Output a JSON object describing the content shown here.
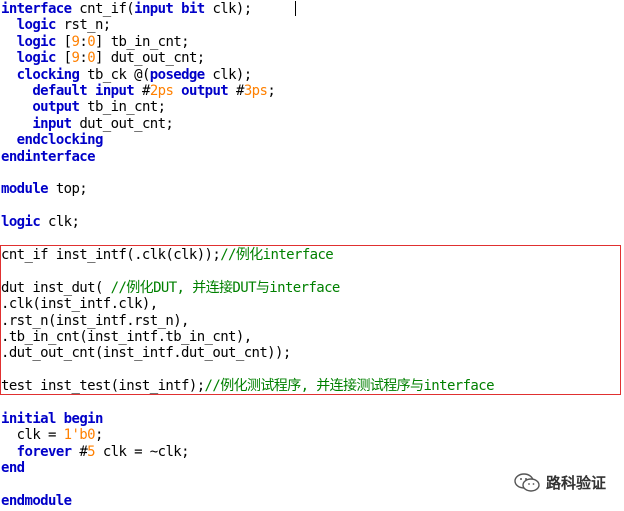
{
  "code_lines": [
    [
      {
        "t": "interface",
        "k": "kw"
      },
      {
        "t": " cnt_if(",
        "k": "id"
      },
      {
        "t": "input",
        "k": "kw"
      },
      {
        "t": " ",
        "k": "id"
      },
      {
        "t": "bit",
        "k": "kw"
      },
      {
        "t": " clk);",
        "k": "id"
      }
    ],
    [
      {
        "t": "  ",
        "k": "id"
      },
      {
        "t": "logic",
        "k": "kw"
      },
      {
        "t": " rst_n;",
        "k": "id"
      }
    ],
    [
      {
        "t": "  ",
        "k": "id"
      },
      {
        "t": "logic",
        "k": "kw"
      },
      {
        "t": " [",
        "k": "id"
      },
      {
        "t": "9",
        "k": "num"
      },
      {
        "t": ":",
        "k": "id"
      },
      {
        "t": "0",
        "k": "num"
      },
      {
        "t": "] tb_in_cnt;",
        "k": "id"
      }
    ],
    [
      {
        "t": "  ",
        "k": "id"
      },
      {
        "t": "logic",
        "k": "kw"
      },
      {
        "t": " [",
        "k": "id"
      },
      {
        "t": "9",
        "k": "num"
      },
      {
        "t": ":",
        "k": "id"
      },
      {
        "t": "0",
        "k": "num"
      },
      {
        "t": "] dut_out_cnt;",
        "k": "id"
      }
    ],
    [
      {
        "t": "  ",
        "k": "id"
      },
      {
        "t": "clocking",
        "k": "kw"
      },
      {
        "t": " tb_ck @(",
        "k": "id"
      },
      {
        "t": "posedge",
        "k": "kw"
      },
      {
        "t": " clk);",
        "k": "id"
      }
    ],
    [
      {
        "t": "    ",
        "k": "id"
      },
      {
        "t": "default",
        "k": "kw"
      },
      {
        "t": " ",
        "k": "id"
      },
      {
        "t": "input",
        "k": "kw"
      },
      {
        "t": " #",
        "k": "id"
      },
      {
        "t": "2ps",
        "k": "num"
      },
      {
        "t": " ",
        "k": "id"
      },
      {
        "t": "output",
        "k": "kw"
      },
      {
        "t": " #",
        "k": "id"
      },
      {
        "t": "3ps",
        "k": "num"
      },
      {
        "t": ";",
        "k": "id"
      }
    ],
    [
      {
        "t": "    ",
        "k": "id"
      },
      {
        "t": "output",
        "k": "kw"
      },
      {
        "t": " tb_in_cnt;",
        "k": "id"
      }
    ],
    [
      {
        "t": "    ",
        "k": "id"
      },
      {
        "t": "input",
        "k": "kw"
      },
      {
        "t": " dut_out_cnt;",
        "k": "id"
      }
    ],
    [
      {
        "t": "  ",
        "k": "id"
      },
      {
        "t": "endclocking",
        "k": "kw"
      }
    ],
    [
      {
        "t": "endinterface",
        "k": "kw"
      }
    ],
    [],
    [
      {
        "t": "module",
        "k": "kw"
      },
      {
        "t": " top;",
        "k": "id"
      }
    ],
    [],
    [
      {
        "t": "logic",
        "k": "kw"
      },
      {
        "t": " clk;",
        "k": "id"
      }
    ],
    [],
    [
      {
        "t": "cnt_if inst_intf(.clk(clk));",
        "k": "id"
      },
      {
        "t": "//例化interface",
        "k": "cm"
      }
    ],
    [],
    [
      {
        "t": "dut inst_dut( ",
        "k": "id"
      },
      {
        "t": "//例化DUT, 并连接DUT与interface",
        "k": "cm"
      }
    ],
    [
      {
        "t": ".clk(inst_intf.clk),",
        "k": "id"
      }
    ],
    [
      {
        "t": ".rst_n(inst_intf.rst_n),",
        "k": "id"
      }
    ],
    [
      {
        "t": ".tb_in_cnt(inst_intf.tb_in_cnt),",
        "k": "id"
      }
    ],
    [
      {
        "t": ".dut_out_cnt(inst_intf.dut_out_cnt));",
        "k": "id"
      }
    ],
    [],
    [
      {
        "t": "test inst_test(inst_intf);",
        "k": "id"
      },
      {
        "t": "//例化测试程序, 并连接测试程序与interface",
        "k": "cm"
      }
    ],
    [],
    [
      {
        "t": "initial",
        "k": "kw"
      },
      {
        "t": " ",
        "k": "id"
      },
      {
        "t": "begin",
        "k": "kw"
      }
    ],
    [
      {
        "t": "  clk = ",
        "k": "id"
      },
      {
        "t": "1'b0",
        "k": "num"
      },
      {
        "t": ";",
        "k": "id"
      }
    ],
    [
      {
        "t": "  ",
        "k": "id"
      },
      {
        "t": "forever",
        "k": "kw"
      },
      {
        "t": " #",
        "k": "id"
      },
      {
        "t": "5",
        "k": "num"
      },
      {
        "t": " clk = ~clk;",
        "k": "id"
      }
    ],
    [
      {
        "t": "end",
        "k": "kw"
      }
    ],
    [],
    [
      {
        "t": "endmodule",
        "k": "kw"
      }
    ]
  ],
  "watermark": {
    "text": "路科验证",
    "icon": "wechat-icon"
  },
  "colors": {
    "keyword": "#0000c8",
    "number": "#ff8000",
    "comment": "#008000",
    "highlight_border": "#e03030"
  }
}
